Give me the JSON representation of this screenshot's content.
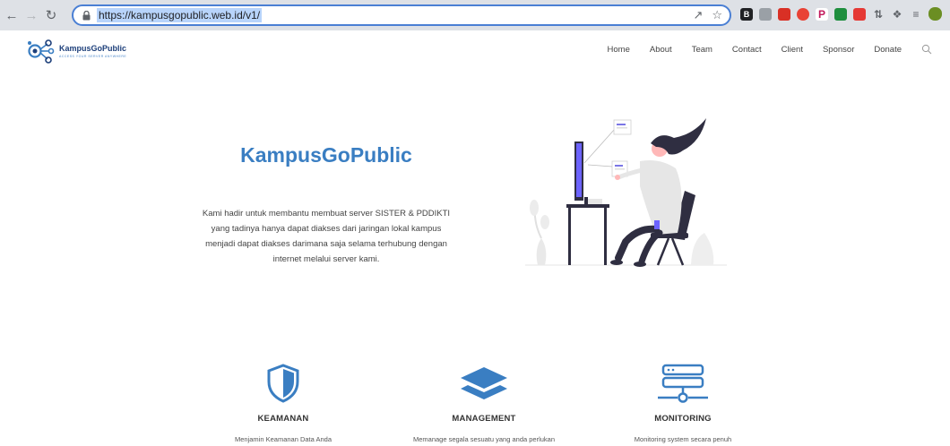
{
  "browser": {
    "url": "https://kampusgopublic.web.id/v1/"
  },
  "site": {
    "logo_name": "KampusGoPublic",
    "logo_tagline": "ACCESS YOUR SERVER ANYWHERE"
  },
  "nav": {
    "items": [
      "Home",
      "About",
      "Team",
      "Contact",
      "Client",
      "Sponsor",
      "Donate"
    ]
  },
  "hero": {
    "title": "KampusGoPublic",
    "description": "Kami hadir untuk membantu membuat server SISTER & PDDIKTI yang tadinya hanya dapat diakses dari jaringan lokal kampus menjadi dapat diakses darimana saja selama terhubung dengan internet melalui server kami."
  },
  "features": [
    {
      "icon": "shield-icon",
      "title": "KEAMANAN",
      "desc": "Menjamin Keamanan Data Anda"
    },
    {
      "icon": "layers-icon",
      "title": "MANAGEMENT",
      "desc": "Memanage segala sesuatu yang anda perlukan"
    },
    {
      "icon": "server-icon",
      "title": "MONITORING",
      "desc": "Monitoring system secara penuh"
    }
  ],
  "colors": {
    "accent": "#3a7ec2",
    "logo_dark": "#1d3f7a"
  }
}
